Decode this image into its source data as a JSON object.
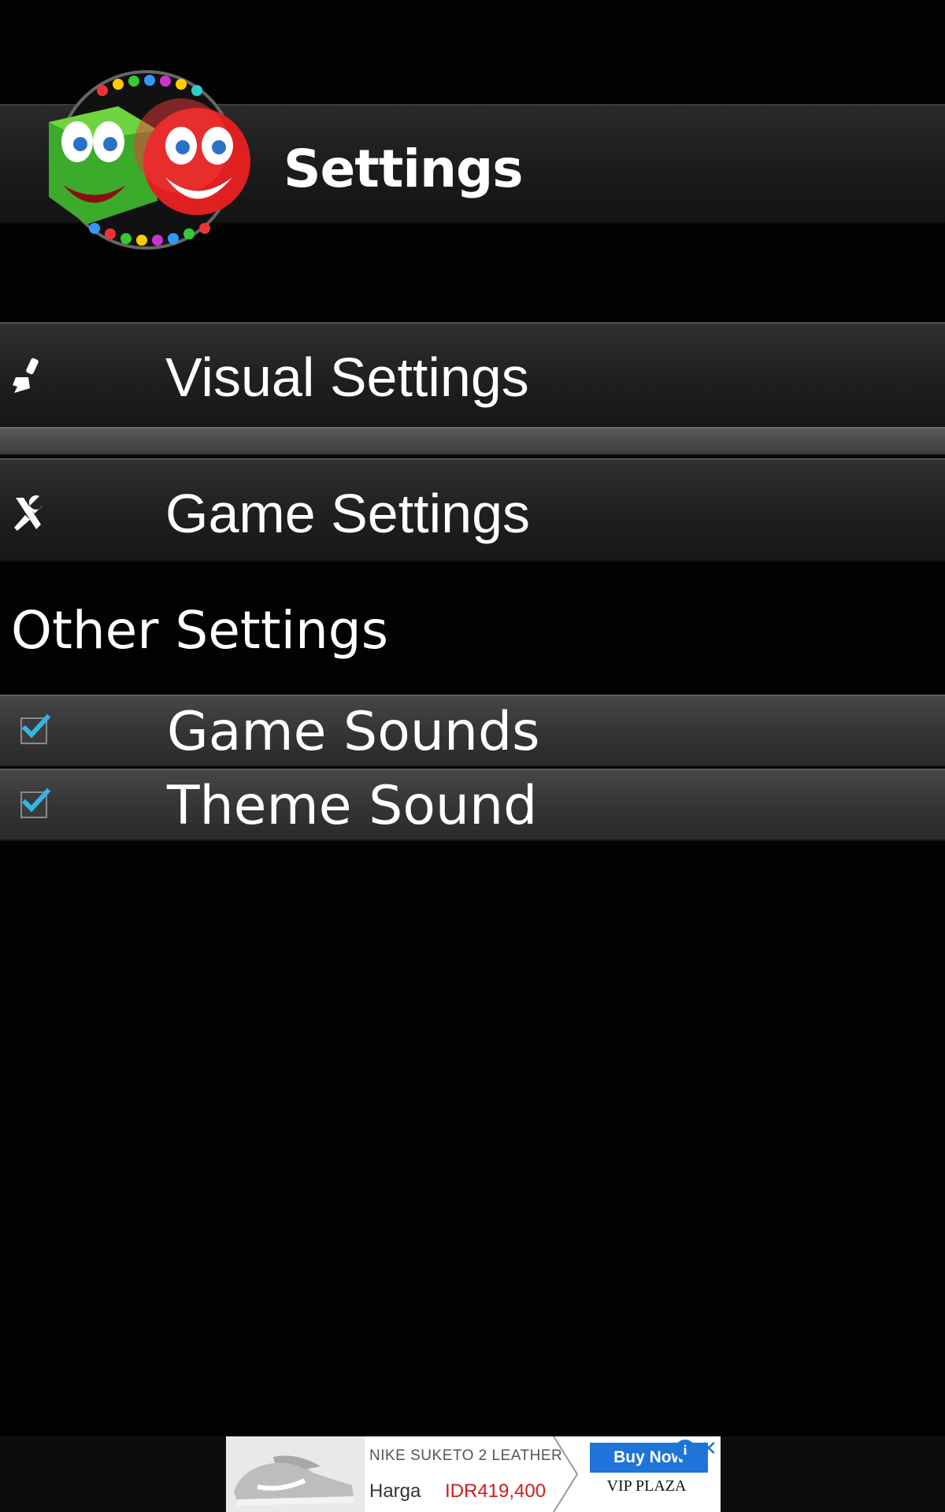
{
  "header": {
    "title": "Settings"
  },
  "menu": {
    "items": [
      {
        "label": "Visual Settings",
        "icon": "brush-icon"
      },
      {
        "label": "Game Settings",
        "icon": "tools-icon"
      }
    ]
  },
  "other": {
    "section_title": "Other Settings",
    "toggles": [
      {
        "label": "Game Sounds",
        "checked": true
      },
      {
        "label": "Theme Sound",
        "checked": true
      }
    ]
  },
  "ad": {
    "product": "NIKE SUKETO 2 LEATHER",
    "price_label": "Harga",
    "price": "IDR419,400",
    "button": "Buy Now",
    "store": "VIP PLAZA",
    "info_glyph": "i",
    "close_glyph": "✕"
  },
  "colors": {
    "background": "#020202",
    "check": "#33b5e5",
    "ad_accent": "#1e74d8",
    "price": "#d11b1b"
  }
}
